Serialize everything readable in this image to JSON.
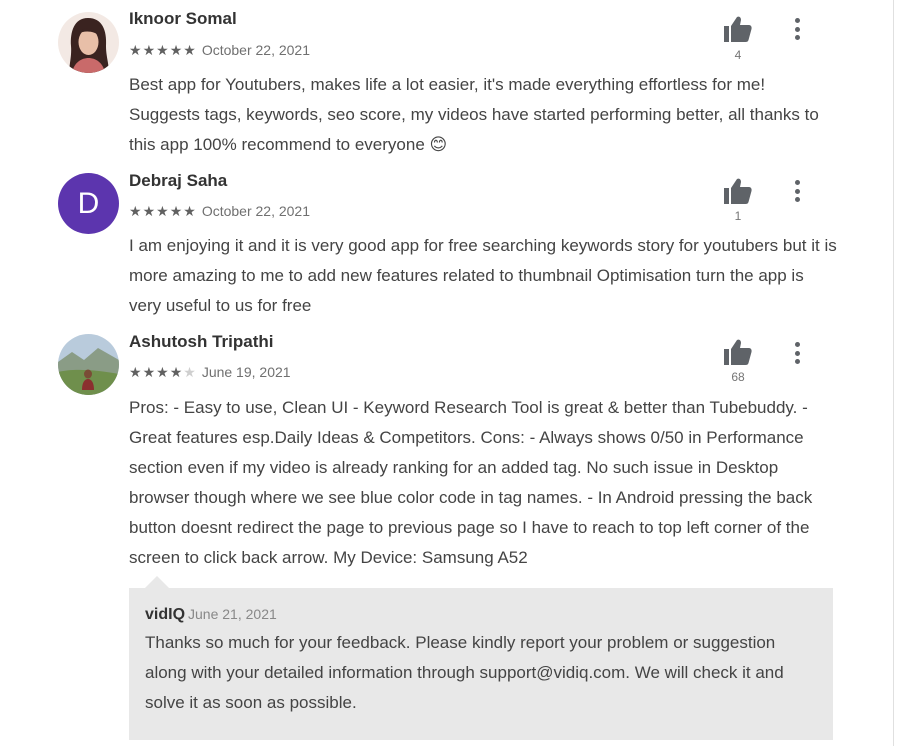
{
  "reviews": [
    {
      "author": "Iknoor Somal",
      "rating": 5,
      "date": "October 22, 2021",
      "text": "Best app for Youtubers, makes life a lot easier, it's made everything effortless for me! Suggests tags, keywords, seo score, my videos have started performing better, all thanks to this app 100% recommend to everyone 😊",
      "helpful_count": "4"
    },
    {
      "author": "Debraj Saha",
      "avatar_letter": "D",
      "rating": 5,
      "date": "October 22, 2021",
      "text": "I am enjoying it and it is very good app for free searching keywords story for youtubers but it is more amazing to me to add new features related to thumbnail Optimisation turn the app is very useful to us for free",
      "helpful_count": "1"
    },
    {
      "author": "Ashutosh Tripathi",
      "rating": 4,
      "date": "June 19, 2021",
      "text": "Pros: - Easy to use, Clean UI - Keyword Research Tool is great & better than Tubebuddy. - Great features esp.Daily Ideas & Competitors. Cons: - Always shows 0/50 in Performance section even if my video is already ranking for an added tag. No such issue in Desktop browser though where we see blue color code in tag names. - In Android pressing the back button doesnt redirect the page to previous page so I have to reach to top left corner of the screen to click back arrow. My Device: Samsung A52",
      "helpful_count": "68",
      "reply": {
        "author": "vidIQ",
        "date": "June 21, 2021",
        "text": "Thanks so much for your feedback. Please kindly report your problem or suggestion along with your detailed information through support@vidiq.com. We will check it and solve it as soon as possible."
      }
    }
  ],
  "icons": {
    "helpful": "thumbs-up-icon",
    "menu": "more-vert-icon",
    "star_filled": "★",
    "star_empty": "★"
  },
  "colors": {
    "avatar_letter_bg": "#5c35ae",
    "reply_bg": "#e8e8e8",
    "icon": "#5f6368"
  }
}
